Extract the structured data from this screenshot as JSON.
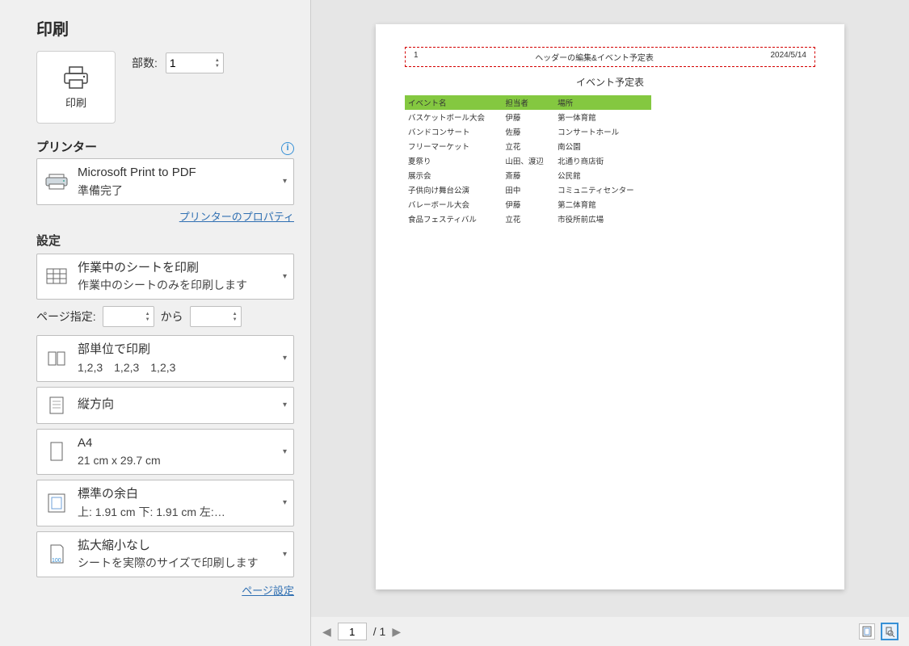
{
  "title": "印刷",
  "print_button_label": "印刷",
  "copies": {
    "label": "部数:",
    "value": "1"
  },
  "printer": {
    "section_label": "プリンター",
    "name": "Microsoft Print to PDF",
    "status": "準備完了",
    "properties_link": "プリンターのプロパティ"
  },
  "settings": {
    "section_label": "設定",
    "what_to_print": {
      "primary": "作業中のシートを印刷",
      "secondary": "作業中のシートのみを印刷します"
    },
    "page_range": {
      "label": "ページ指定:",
      "from": "",
      "to_label": "から",
      "to": ""
    },
    "collate": {
      "primary": "部単位で印刷",
      "secondary": "1,2,3　1,2,3　1,2,3"
    },
    "orientation": {
      "primary": "縦方向"
    },
    "paper": {
      "primary": "A4",
      "secondary": "21 cm x 29.7 cm"
    },
    "margins": {
      "primary": "標準の余白",
      "secondary": "上: 1.91 cm 下: 1.91 cm 左:…"
    },
    "scaling": {
      "primary": "拡大縮小なし",
      "secondary": "シートを実際のサイズで印刷します"
    },
    "page_setup_link": "ページ設定"
  },
  "preview": {
    "header": {
      "left": "1",
      "center": "ヘッダーの編集&イベント予定表",
      "right": "2024/5/14"
    },
    "doc_title": "イベント予定表",
    "columns": [
      "イベント名",
      "担当者",
      "場所"
    ],
    "rows": [
      [
        "バスケットボール大会",
        "伊藤",
        "第一体育館"
      ],
      [
        "バンドコンサート",
        "佐藤",
        "コンサートホール"
      ],
      [
        "フリーマーケット",
        "立花",
        "南公園"
      ],
      [
        "夏祭り",
        "山田、渡辺",
        "北通り商店街"
      ],
      [
        "展示会",
        "斎藤",
        "公民館"
      ],
      [
        "子供向け舞台公演",
        "田中",
        "コミュニティセンター"
      ],
      [
        "バレーボール大会",
        "伊藤",
        "第二体育館"
      ],
      [
        "食品フェスティバル",
        "立花",
        "市役所前広場"
      ]
    ]
  },
  "nav": {
    "current": "1",
    "total": "/ 1"
  }
}
